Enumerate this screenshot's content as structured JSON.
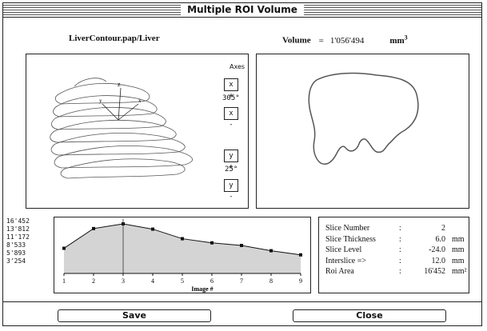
{
  "window": {
    "title": "Multiple ROI Volume"
  },
  "header": {
    "contour_label": "LiverContour.pap/Liver",
    "volume_label": "Volume",
    "volume_eq": "=",
    "volume_value": "1'056'494",
    "volume_unit": "mm",
    "volume_unit_sup": "3"
  },
  "view3d": {
    "axes_label": "Axes",
    "x_plus": "x +",
    "x_minus": "x -",
    "x_angle": "305°",
    "y_plus": "y +",
    "y_minus": "y -",
    "y_angle": "25°",
    "axis_labels": [
      "z",
      "x",
      "y"
    ]
  },
  "chart_data": {
    "type": "area",
    "x": [
      1,
      2,
      3,
      4,
      5,
      6,
      7,
      8,
      9
    ],
    "values": [
      9950,
      15200,
      16452,
      15050,
      12500,
      11400,
      10700,
      9300,
      8200
    ],
    "y_tick_labels": [
      "16'452",
      "13'812",
      "11'172",
      "8'533",
      "5'893",
      "3'254"
    ],
    "xlabel": "Image #",
    "x_tick_labels": [
      "1",
      "2",
      "3",
      "4",
      "5",
      "6",
      "7",
      "8",
      "9"
    ],
    "ylim": [
      3254,
      16452
    ],
    "selected_x": 3,
    "fill_color": "#d4d4d4",
    "line_color": "#111111"
  },
  "info": {
    "rows": [
      {
        "label": "Slice Number",
        "sep": ":",
        "value": "2",
        "unit": ""
      },
      {
        "label": "Slice Thickness",
        "sep": ":",
        "value": "6.0",
        "unit": "mm"
      },
      {
        "label": "Slice Level",
        "sep": ":",
        "value": "-24.0",
        "unit": "mm"
      },
      {
        "label": "Interslice =>",
        "sep": ":",
        "value": "12.0",
        "unit": "mm"
      },
      {
        "label": "Roi Area",
        "sep": ":",
        "value": "16'452",
        "unit": "mm²"
      }
    ]
  },
  "buttons": {
    "save": "Save",
    "close": "Close"
  }
}
